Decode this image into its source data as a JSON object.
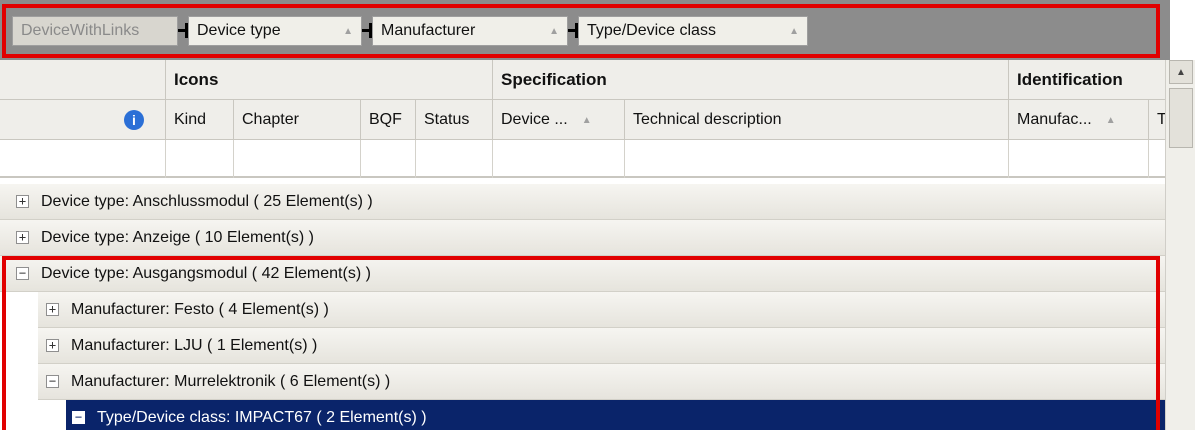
{
  "group_panel": {
    "root": "DeviceWithLinks",
    "chips": [
      {
        "label": "Device type",
        "sort": "▲"
      },
      {
        "label": "Manufacturer",
        "sort": "▲"
      },
      {
        "label": "Type/Device class",
        "sort": "▲"
      }
    ]
  },
  "bands": [
    "Icons",
    "Specification",
    "Identification"
  ],
  "columns": {
    "info_icon": "i",
    "kind": "Kind",
    "chapter": "Chapter",
    "bqf": "BQF",
    "status": "Status",
    "device": "Device ...",
    "device_sort": "▲",
    "technical_description": "Technical description",
    "manufacturer": "Manufac...",
    "manufacturer_sort": "▲",
    "overflow": "T"
  },
  "rows": [
    {
      "text": "Device type:  Anschlussmodul  ( 25 Element(s) )",
      "toggle": "+"
    },
    {
      "text": "Device type:  Anzeige  ( 10 Element(s) )",
      "toggle": "+"
    },
    {
      "text": "Device type:  Ausgangsmodul  ( 42 Element(s) )",
      "toggle": "−"
    },
    {
      "text": "Manufacturer:  Festo  ( 4 Element(s) )",
      "toggle": "+"
    },
    {
      "text": "Manufacturer:  LJU  ( 1 Element(s) )",
      "toggle": "+"
    },
    {
      "text": "Manufacturer:  Murrelektronik  ( 6 Element(s) )",
      "toggle": "−"
    },
    {
      "text": "Type/Device class:  IMPACT67  ( 2 Element(s) )",
      "toggle": "−"
    }
  ],
  "scrollbar": {
    "up_arrow": "▲"
  },
  "colors": {
    "highlight": "#e10000",
    "selection": "#0a246a",
    "group_panel": "#8c8c8c"
  }
}
